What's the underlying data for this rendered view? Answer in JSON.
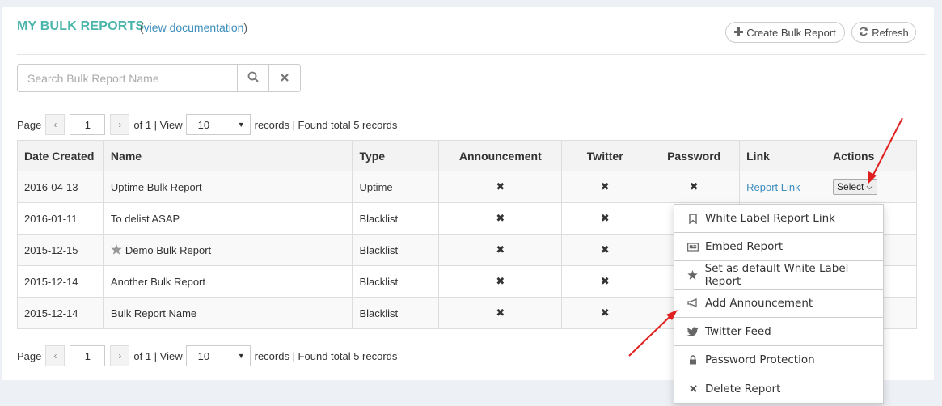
{
  "header": {
    "title": "MY BULK REPORTS",
    "paren_open": "(",
    "doc_link": "view documentation",
    "paren_close": ")",
    "create_label": "Create Bulk Report",
    "refresh_label": "Refresh"
  },
  "search": {
    "placeholder": "Search Bulk Report Name"
  },
  "pager": {
    "page_label": "Page",
    "page_value": "1",
    "of_text": "of 1 | View",
    "view_value": "10",
    "records_text": "records | Found total 5 records"
  },
  "table": {
    "headers": [
      "Date Created",
      "Name",
      "Type",
      "Announcement",
      "Twitter",
      "Password",
      "Link",
      "Actions"
    ],
    "rows": [
      {
        "date": "2016-04-13",
        "name": "Uptime Bulk Report",
        "type": "Uptime",
        "announcement": "✖",
        "twitter": "✖",
        "password": "✖",
        "link": "Report Link",
        "action": "Select"
      },
      {
        "date": "2016-01-11",
        "name": "To delist ASAP",
        "type": "Blacklist",
        "announcement": "✖",
        "twitter": "✖"
      },
      {
        "date": "2015-12-15",
        "name": "Demo Bulk Report",
        "type": "Blacklist",
        "announcement": "✖",
        "twitter": "✖"
      },
      {
        "date": "2015-12-14",
        "name": "Another Bulk Report",
        "type": "Blacklist",
        "announcement": "✖",
        "twitter": "✖"
      },
      {
        "date": "2015-12-14",
        "name": "Bulk Report Name",
        "type": "Blacklist",
        "announcement": "✖",
        "twitter": "✖"
      }
    ]
  },
  "dropdown": {
    "items": [
      {
        "label": "White Label Report Link",
        "icon": "bookmark-icon"
      },
      {
        "label": "Embed Report",
        "icon": "embed-icon"
      },
      {
        "label": "Set as default White Label Report",
        "icon": "star-icon"
      },
      {
        "label": "Add Announcement",
        "icon": "megaphone-icon"
      },
      {
        "label": "Twitter Feed",
        "icon": "twitter-icon"
      },
      {
        "label": "Password Protection",
        "icon": "lock-icon"
      },
      {
        "label": "Delete Report",
        "icon": "close-icon"
      }
    ]
  },
  "colors": {
    "title": "#4cb5ab",
    "link": "#3c8dbc",
    "arrow": "#e02020"
  }
}
